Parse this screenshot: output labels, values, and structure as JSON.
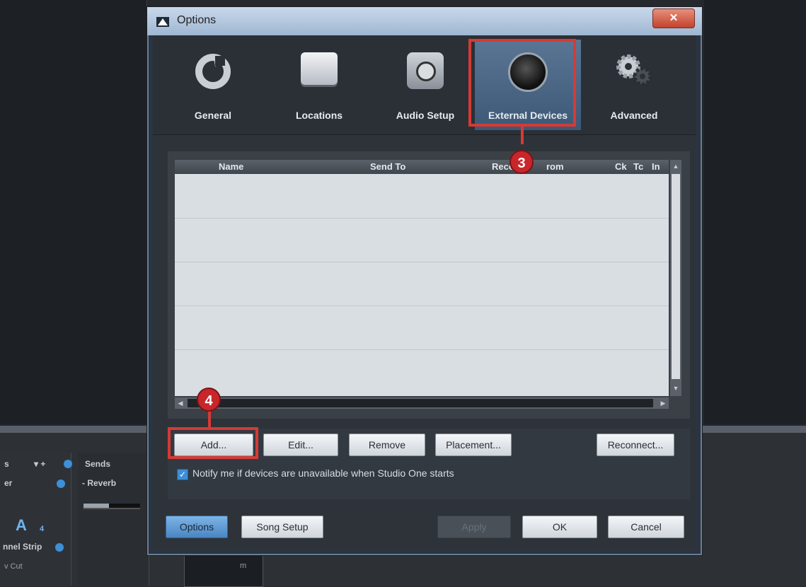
{
  "window": {
    "title": "Options",
    "close_label": "✕"
  },
  "tabs": [
    {
      "label": "General"
    },
    {
      "label": "Locations"
    },
    {
      "label": "Audio Setup"
    },
    {
      "label": "External Devices",
      "active": true
    },
    {
      "label": "Advanced"
    }
  ],
  "device_list": {
    "columns": [
      "Name",
      "Send To",
      "Rece",
      "rom",
      "Ck",
      "Tc",
      "In"
    ],
    "rows": []
  },
  "buttons": {
    "add": "Add...",
    "edit": "Edit...",
    "remove": "Remove",
    "placement": "Placement...",
    "reconnect": "Reconnect..."
  },
  "notify": {
    "checked": true,
    "label": "Notify me if devices are unavailable when Studio One starts"
  },
  "footer": {
    "options": "Options",
    "song_setup": "Song Setup",
    "apply": "Apply",
    "ok": "OK",
    "cancel": "Cancel"
  },
  "markers": [
    "3",
    "4"
  ],
  "background_app": {
    "sends_label": "Sends",
    "reverb_label": "- Reverb",
    "channel_strip_label": "nnel Strip",
    "big_letter": "A",
    "small_digit": "4",
    "partial_left_1": "s",
    "partial_left_2": "er",
    "partial_left_3": "v Cut",
    "controls_label": "▾ +",
    "fader_label": "m"
  },
  "colors": {
    "highlight": "#d63a35",
    "active_tab": "#4b6888",
    "accent_blue": "#3c8fd8"
  }
}
